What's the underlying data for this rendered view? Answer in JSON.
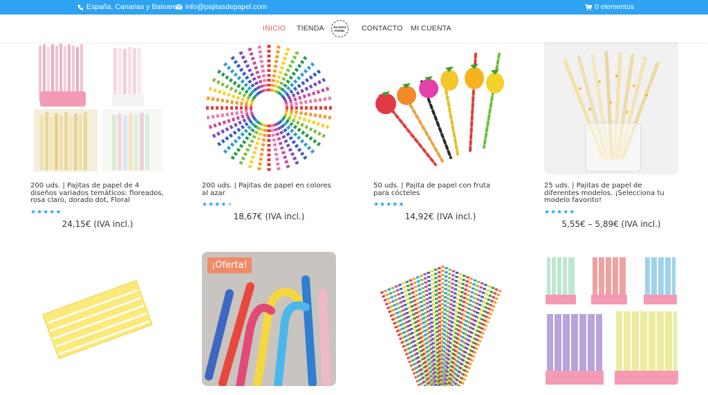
{
  "topbar": {
    "location": "España, Canarias y Baleares",
    "email": "info@pajitasdepapel.com",
    "cart": "0 elementos",
    "bg_color": "#2ea3f2"
  },
  "nav": {
    "items": [
      "INICIO",
      "TIENDA",
      "CONTACTO",
      "MI CUENTA"
    ],
    "active": "INICIO",
    "logo_text_line1": "PAJITAS",
    "logo_text_line2": "PAPEL"
  },
  "products": [
    {
      "title": "200 uds. | Pajitas de papel de 4 diseños variados temáticos: floreados, rosa claro, dorado dot, Floral",
      "rating": 5,
      "price": "24,15€ (IVA incl.)"
    },
    {
      "title": "200 uds. | Pajitas de papel en colores al azar",
      "rating": 4,
      "price": "18,67€ (IVA incl.)"
    },
    {
      "title": "50 uds. | Pajita de papel con fruta para cócteles",
      "rating": 5,
      "price": "14,92€ (IVA incl.)"
    },
    {
      "title": "25 uds. | Pajitas de papel de diferentes modelos. ¡Selecciona tu modelo favorito!",
      "rating": 5,
      "price": "5,55€ – 5,89€ (IVA incl.)"
    },
    {
      "badge": "¡Oferta!"
    }
  ],
  "colors": {
    "accent": "#2ea3f2",
    "active_nav": "#e05a5a",
    "sale_badge": "#ef8b67"
  }
}
